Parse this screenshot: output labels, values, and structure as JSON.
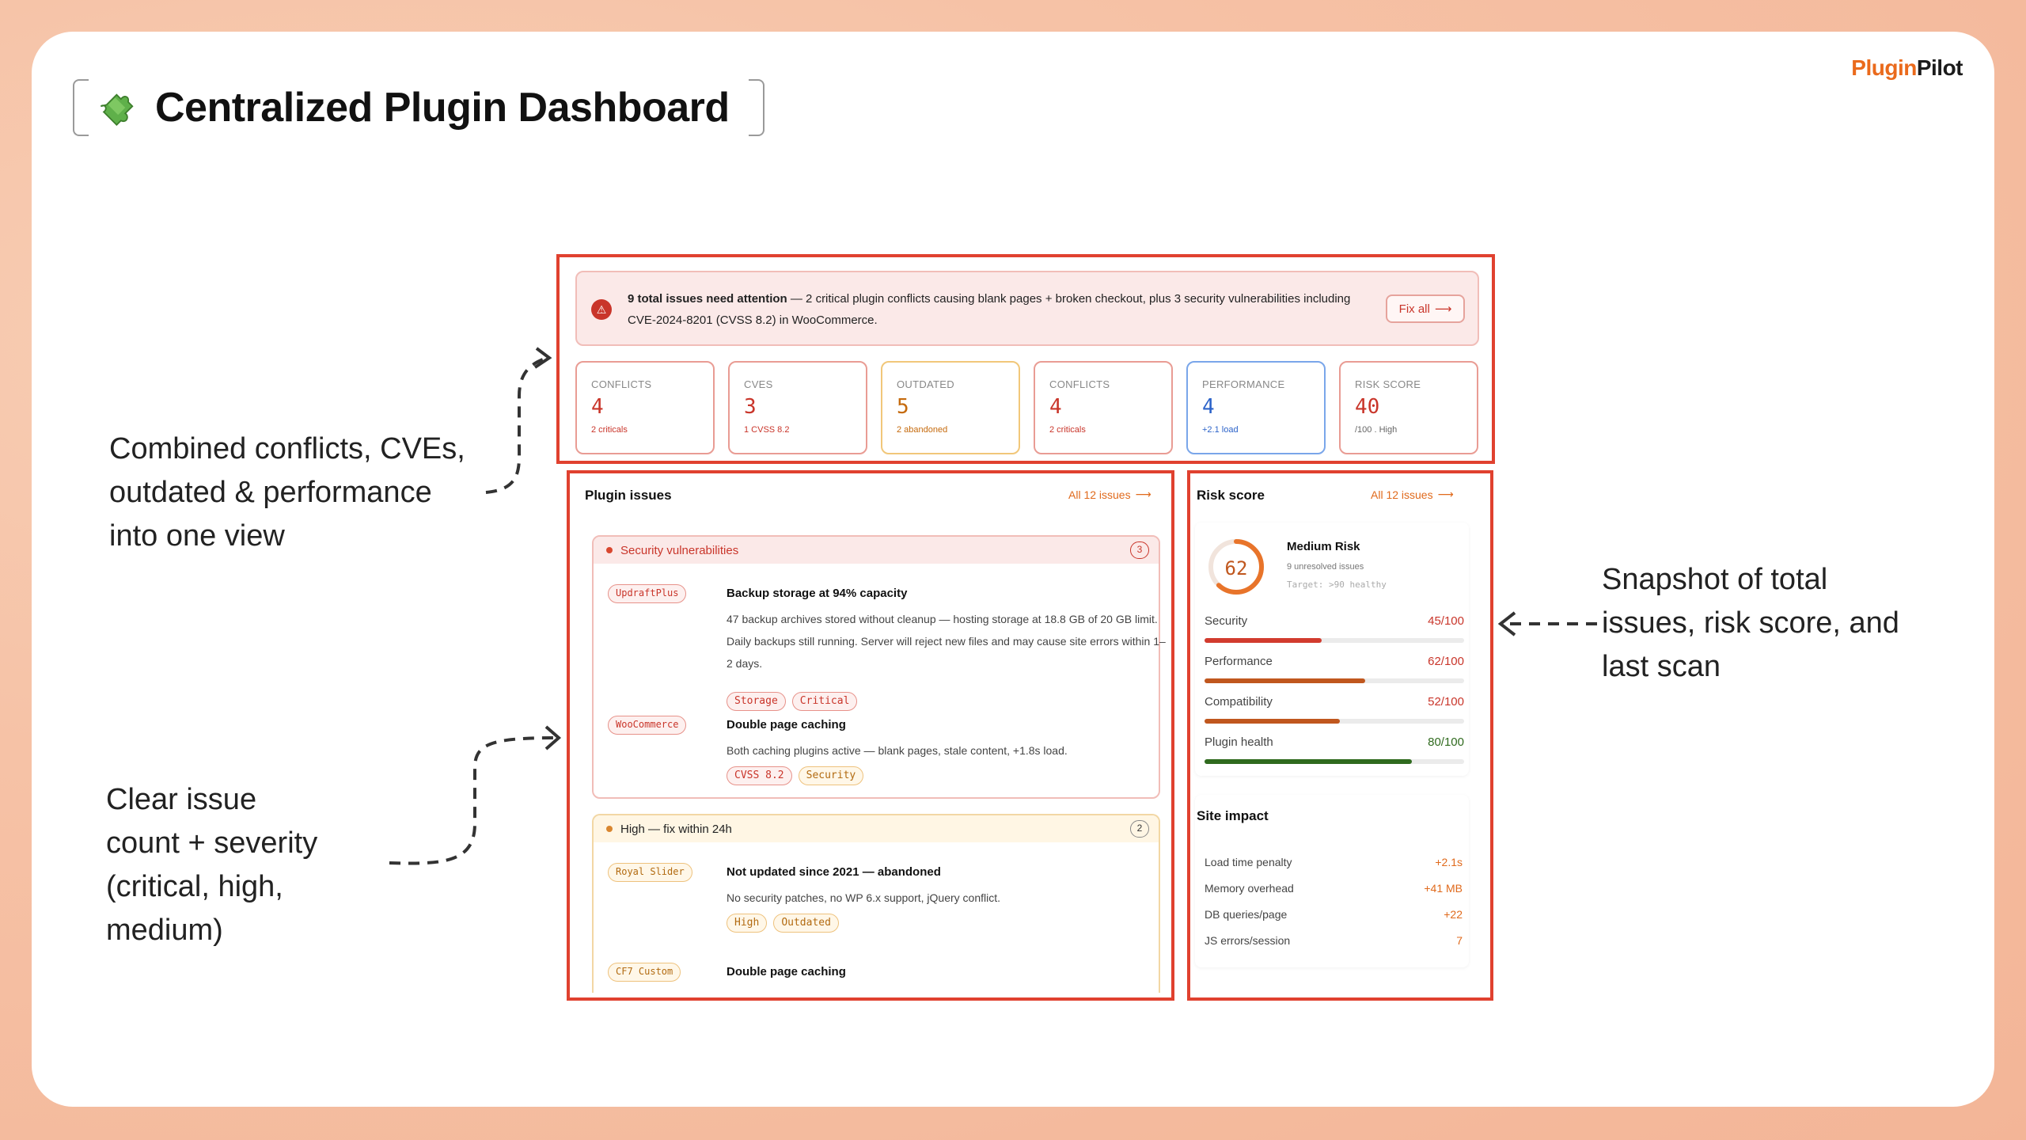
{
  "brand": {
    "part1": "Plugin",
    "part2": "Pilot"
  },
  "title": "Centralized Plugin Dashboard",
  "annotations": {
    "left_top": [
      "Combined conflicts, CVEs,",
      "outdated & performance",
      "into one view"
    ],
    "left_bottom": [
      "Clear issue",
      "count + severity",
      "(critical, high,",
      "medium)"
    ],
    "right": [
      "Snapshot of total",
      "issues, risk score, and",
      "last scan"
    ]
  },
  "alert": {
    "bold": "9 total issues need attention",
    "text": " — 2 critical plugin conflicts causing blank pages + broken checkout, plus 3 security vulnerabilities including CVE-2024-8201 (CVSS 8.2) in WooCommerce.",
    "button": "Fix all"
  },
  "stats": [
    {
      "label": "CONFLICTS",
      "value": "4",
      "sub": "2 criticals"
    },
    {
      "label": "CVES",
      "value": "3",
      "sub": "1 CVSS 8.2"
    },
    {
      "label": "OUTDATED",
      "value": "5",
      "sub": "2 abandoned"
    },
    {
      "label": "CONFLICTS",
      "value": "4",
      "sub": "2 criticals"
    },
    {
      "label": "PERFORMANCE",
      "value": "4",
      "sub": "+2.1 load"
    },
    {
      "label": "RISK SCORE",
      "value": "40",
      "sub": "/100 . High"
    }
  ],
  "plugin_issues": {
    "title": "Plugin issues",
    "link": "All 12 issues",
    "groups": [
      {
        "name": "Security vulnerabilities",
        "count": "3",
        "items": [
          {
            "tag": "UpdraftPlus",
            "title": "Backup storage at 94% capacity",
            "desc": "47 backup archives stored without cleanup — hosting storage at 18.8 GB of 20 GB limit. Daily backups still running. Server will reject new files and may cause site errors within 1–2 days.",
            "chips": [
              "Storage",
              "Critical"
            ]
          },
          {
            "tag": "WooCommerce",
            "title": "Double page caching",
            "desc": "Both caching plugins active — blank pages, stale content, +1.8s load.",
            "chips": [
              "CVSS 8.2",
              "Security"
            ]
          }
        ]
      },
      {
        "name": "High — fix within 24h",
        "count": "2",
        "items": [
          {
            "tag": "Royal Slider",
            "title": "Not updated since 2021 — abandoned",
            "desc": "No security patches, no WP 6.x support, jQuery conflict.",
            "chips": [
              "High",
              "Outdated"
            ]
          },
          {
            "tag": "CF7 Custom",
            "title": "Double page caching"
          }
        ]
      }
    ]
  },
  "risk": {
    "title": "Risk score",
    "link": "All 12 issues",
    "score": "62",
    "level": "Medium Risk",
    "unresolved": "9 unresolved issues",
    "target": "Target: >90 healthy",
    "metrics": [
      {
        "label": "Security",
        "value": "45/100",
        "pct": 45,
        "color": "#d23b2e"
      },
      {
        "label": "Performance",
        "value": "62/100",
        "pct": 62,
        "color": "#c0571e"
      },
      {
        "label": "Compatibility",
        "value": "52/100",
        "pct": 52,
        "color": "#c0571e"
      },
      {
        "label": "Plugin health",
        "value": "80/100",
        "pct": 80,
        "color": "#2f6a1e"
      }
    ]
  },
  "site_impact": {
    "title": "Site impact",
    "rows": [
      {
        "label": "Load time penalty",
        "value": "+2.1s"
      },
      {
        "label": "Memory overhead",
        "value": "+41 MB"
      },
      {
        "label": "DB queries/page",
        "value": "+22"
      },
      {
        "label": "JS errors/session",
        "value": "7"
      }
    ]
  },
  "colors": {
    "accent": "#e0412f",
    "brand": "#ea6a1c",
    "critical": "#c9352a",
    "high": "#c56a0d",
    "info": "#2c63c9",
    "good": "#2f6a1e"
  },
  "icons": {
    "alert": "warning-triangle-icon",
    "title": "puzzle-piece-icon",
    "arrow": "arrow-right-icon"
  }
}
